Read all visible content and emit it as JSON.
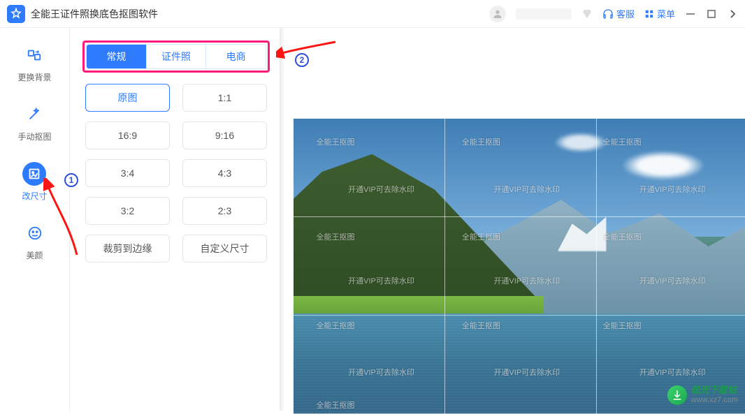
{
  "app": {
    "title": "全能王证件照换底色抠图软件"
  },
  "titlebar": {
    "service_label": "客服",
    "menu_label": "菜单"
  },
  "sidebar": {
    "items": [
      {
        "label": "更换背景"
      },
      {
        "label": "手动抠图"
      },
      {
        "label": "改尺寸"
      },
      {
        "label": "美颜"
      }
    ]
  },
  "tabs": {
    "items": [
      {
        "label": "常规"
      },
      {
        "label": "证件照"
      },
      {
        "label": "电商"
      }
    ]
  },
  "sizes": {
    "items": [
      "原图",
      "1:1",
      "16:9",
      "9:16",
      "3:4",
      "4:3",
      "3:2",
      "2:3",
      "裁剪到边缘",
      "自定义尺寸"
    ]
  },
  "annotations": {
    "badge1": "1",
    "badge2": "2"
  },
  "watermark": {
    "wm1": "全能王抠图",
    "wm2": "开通VIP可去除水印"
  },
  "site": {
    "name": "极光下载站",
    "url": "www.xz7.com"
  }
}
